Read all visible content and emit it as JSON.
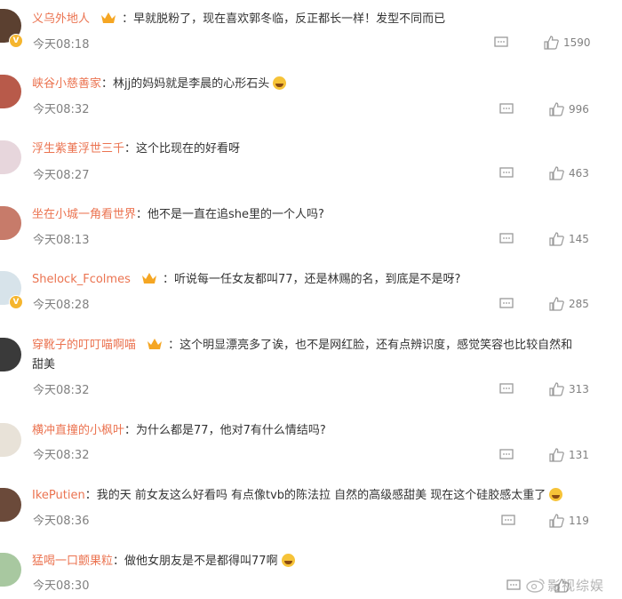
{
  "comments": [
    {
      "username": "义乌外地人",
      "has_crown": true,
      "vip": true,
      "separator": "：",
      "text": "早就脱粉了，现在喜欢郭冬临，反正都长一样！发型不同而已",
      "emoji": false,
      "time": "今天08:18",
      "likes": "1590",
      "avatar_color": "#5b4030"
    },
    {
      "username": "峡谷小慈善家",
      "has_crown": false,
      "vip": false,
      "separator": "：",
      "text": "林jj的妈妈就是李晨的心形石头",
      "emoji": true,
      "time": "今天08:32",
      "likes": "996",
      "avatar_color": "#b85a4a"
    },
    {
      "username": "浮生紫堇浮世三千",
      "has_crown": false,
      "vip": false,
      "separator": "：",
      "text": "这个比现在的好看呀",
      "emoji": false,
      "time": "今天08:27",
      "likes": "463",
      "avatar_color": "#e7d6dc"
    },
    {
      "username": "坐在小城一角看世界",
      "has_crown": false,
      "vip": false,
      "separator": "：",
      "text": "他不是一直在追she里的一个人吗?",
      "emoji": false,
      "time": "今天08:13",
      "likes": "145",
      "avatar_color": "#c77b6a"
    },
    {
      "username": "Shelock_Fcolmes",
      "has_crown": true,
      "vip": true,
      "separator": "：",
      "text": "听说每一任女友都叫77，还是林赐的名，到底是不是呀?",
      "emoji": false,
      "time": "今天08:28",
      "likes": "285",
      "avatar_color": "#d7e3ea"
    },
    {
      "username": "穿靴子的叮叮喵啊喵",
      "has_crown": true,
      "vip": false,
      "separator": "：",
      "text": "这个明显漂亮多了诶，也不是网红脸，还有点辨识度，感觉笑容也比较自然和",
      "text2": "甜美",
      "emoji": false,
      "time": "今天08:32",
      "likes": "313",
      "avatar_color": "#3a3a3a"
    },
    {
      "username": "横冲直撞的小枫叶",
      "has_crown": false,
      "vip": false,
      "separator": "：",
      "text": "为什么都是77，他对7有什么情结吗?",
      "emoji": false,
      "time": "今天08:32",
      "likes": "131",
      "avatar_color": "#e8e2d8"
    },
    {
      "username": "IkePutien",
      "has_crown": false,
      "vip": false,
      "separator": "：",
      "text": "我的天 前女友这么好看吗 有点像tvb的陈法拉 自然的高级感甜美 现在这个硅胶感太重了",
      "emoji": true,
      "time": "今天08:36",
      "likes": "119",
      "avatar_color": "#6b4a3a"
    },
    {
      "username": "猛喝一口颤果粒",
      "has_crown": false,
      "vip": false,
      "separator": "：",
      "text": "做他女朋友是不是都得叫77啊",
      "emoji": true,
      "time": "今天08:30",
      "likes": "",
      "avatar_color": "#a8c8a0"
    }
  ],
  "watermark": {
    "text": "影视综娱"
  },
  "colors": {
    "username": "#eb7350",
    "meta": "#808080",
    "text": "#333333"
  }
}
